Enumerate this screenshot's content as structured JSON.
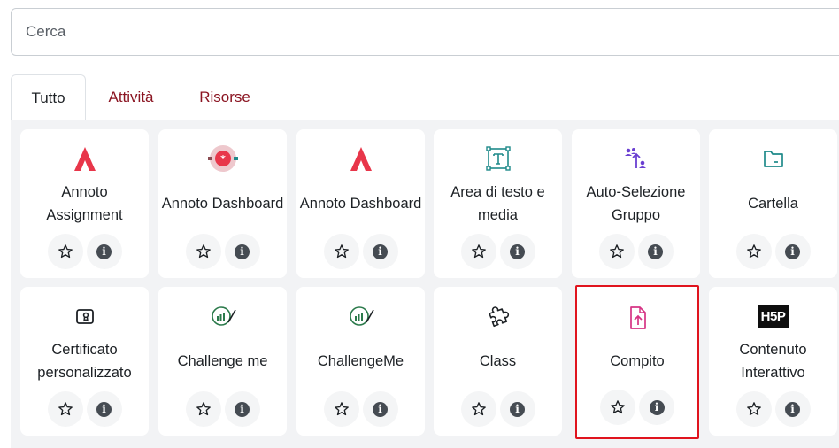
{
  "search": {
    "placeholder": "Cerca",
    "value": ""
  },
  "tabs": [
    {
      "label": "Tutto",
      "active": true
    },
    {
      "label": "Attività",
      "active": false
    },
    {
      "label": "Risorse",
      "active": false
    }
  ],
  "colors": {
    "annoto_red": "#e8364a",
    "assignment_pink": "#d63384",
    "content_teal": "#1f8a8a",
    "collab_purple": "#6a3fd1",
    "selection_red": "#e0141e",
    "tab_link": "#8b1522"
  },
  "modules": [
    {
      "name": "Annoto Assignment",
      "icon": "annoto-logo-icon"
    },
    {
      "name": "Annoto Dashboard",
      "icon": "annoto-dashboard-icon"
    },
    {
      "name": "Annoto Dashboard",
      "icon": "annoto-logo-icon"
    },
    {
      "name": "Area di testo e media",
      "icon": "text-media-area-icon"
    },
    {
      "name": "Auto-Selezione Gruppo",
      "icon": "group-self-selection-icon"
    },
    {
      "name": "Cartella",
      "icon": "folder-icon"
    },
    {
      "name": "Certificato personalizzato",
      "icon": "certificate-icon"
    },
    {
      "name": "Challenge me",
      "icon": "challenge-me-icon"
    },
    {
      "name": "ChallengeMe",
      "icon": "challenge-me-icon"
    },
    {
      "name": "Class",
      "icon": "puzzle-icon"
    },
    {
      "name": "Compito",
      "icon": "assignment-upload-icon",
      "selected": true
    },
    {
      "name": "Contenuto Interattivo",
      "icon": "h5p-logo-icon",
      "logo_text": "H5P"
    }
  ]
}
